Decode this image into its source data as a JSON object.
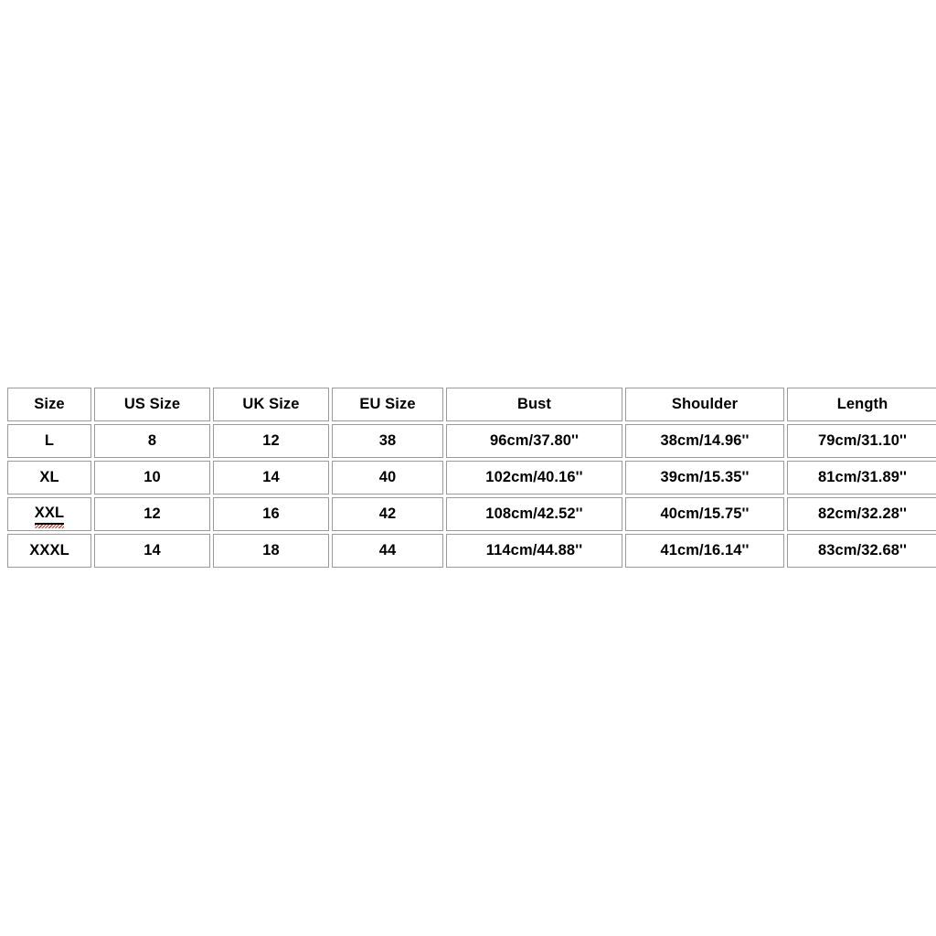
{
  "document": {
    "background_color": "#ffffff",
    "table_border_color": "#9a9a9a",
    "text_color": "#000000",
    "spellcheck_underline_color": "#c0392b"
  },
  "chart_data": {
    "type": "table",
    "title": "",
    "columns": [
      "Size",
      "US Size",
      "UK Size",
      "EU Size",
      "Bust",
      "Shoulder",
      "Length"
    ],
    "rows": [
      [
        "L",
        "8",
        "12",
        "38",
        "96cm/37.80''",
        "38cm/14.96''",
        "79cm/31.10''"
      ],
      [
        "XL",
        "10",
        "14",
        "40",
        "102cm/40.16''",
        "39cm/15.35''",
        "81cm/31.89''"
      ],
      [
        "XXL",
        "12",
        "16",
        "42",
        "108cm/42.52''",
        "40cm/15.75''",
        "82cm/32.28''"
      ],
      [
        "XXXL",
        "14",
        "18",
        "44",
        "114cm/44.88''",
        "41cm/16.14''",
        "83cm/32.68''"
      ]
    ]
  },
  "table": {
    "headers": {
      "size": "Size",
      "us_size": "US Size",
      "uk_size": "UK Size",
      "eu_size": "EU Size",
      "bust": "Bust",
      "shoulder": "Shoulder",
      "length": "Length"
    },
    "rows": [
      {
        "size": "L",
        "us_size": "8",
        "uk_size": "12",
        "eu_size": "38",
        "bust": "96cm/37.80''",
        "shoulder": "38cm/14.96''",
        "length": "79cm/31.10''",
        "size_marked": false
      },
      {
        "size": "XL",
        "us_size": "10",
        "uk_size": "14",
        "eu_size": "40",
        "bust": "102cm/40.16''",
        "shoulder": "39cm/15.35''",
        "length": "81cm/31.89''",
        "size_marked": false
      },
      {
        "size": "XXL",
        "us_size": "12",
        "uk_size": "16",
        "eu_size": "42",
        "bust": "108cm/42.52''",
        "shoulder": "40cm/15.75''",
        "length": "82cm/32.28''",
        "size_marked": true
      },
      {
        "size": "XXXL",
        "us_size": "14",
        "uk_size": "18",
        "eu_size": "44",
        "bust": "114cm/44.88''",
        "shoulder": "41cm/16.14''",
        "length": "83cm/32.68''",
        "size_marked": false
      }
    ]
  }
}
